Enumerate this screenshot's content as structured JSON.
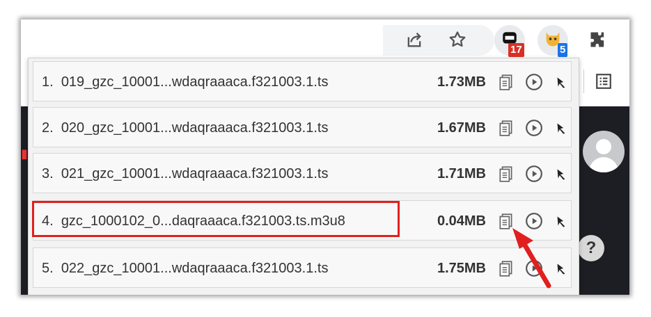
{
  "colors": {
    "highlight": "#e0201f",
    "badge_red": "#d93025",
    "badge_blue": "#1a73e8",
    "dark_page": "#1d1d24"
  },
  "toolbar": {
    "icons": [
      "share-icon",
      "star-icon",
      "extension-badge-icon",
      "cat-extension-icon",
      "puzzle-icon",
      "reading-list-icon"
    ],
    "badge_red": "17",
    "badge_blue": "5"
  },
  "page": {
    "help_label": "?"
  },
  "files": [
    {
      "index": "1.",
      "name": "019_gzc_10001...wdaqraaaca.f321003.1.ts",
      "size": "1.73MB"
    },
    {
      "index": "2.",
      "name": "020_gzc_10001...wdaqraaaca.f321003.1.ts",
      "size": "1.67MB"
    },
    {
      "index": "3.",
      "name": "021_gzc_10001...wdaqraaaca.f321003.1.ts",
      "size": "1.71MB"
    },
    {
      "index": "4.",
      "name": "gzc_1000102_0...daqraaaca.f321003.ts.m3u8",
      "size": "0.04MB"
    },
    {
      "index": "5.",
      "name": "022_gzc_10001...wdaqraaaca.f321003.1.ts",
      "size": "1.75MB"
    }
  ],
  "annotation": {
    "highlighted_row": 4,
    "arrow_target": "copy-icon"
  }
}
